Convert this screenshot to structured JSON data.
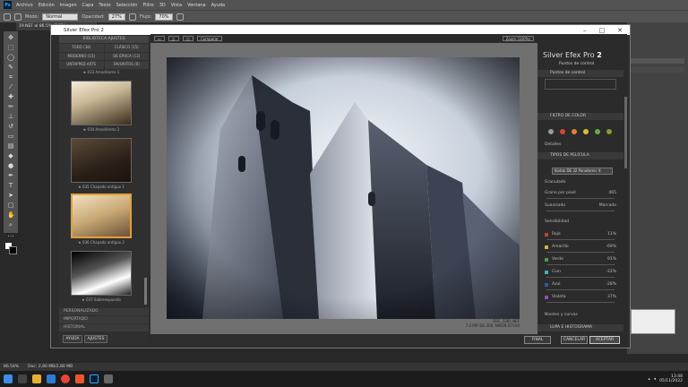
{
  "menu": {
    "items": [
      "Archivo",
      "Edición",
      "Imagen",
      "Capa",
      "Texto",
      "Selección",
      "Filtro",
      "3D",
      "Vista",
      "Ventana",
      "Ayuda"
    ]
  },
  "options": {
    "mode_label": "Modo:",
    "mode": "Normal",
    "opacity_label": "Opacidad:",
    "opacity": "27%",
    "flow_label": "Flujo:",
    "flow": "70%"
  },
  "doc_tab": "19.NEF al 86.5% (RGB/...",
  "silver": {
    "title": "Silver Efex Pro 2",
    "brand": "Silver Efex Pro",
    "brand_num": "2",
    "lib_header": "BIBLIOTECA AJUSTES",
    "tabs": [
      "TODO (38)",
      "CLÁSICO (15)",
      "MODERNO (15)",
      "DE ÉPOCA (13)",
      "UNTAPPED ARTS",
      "FAVORITOS (0)"
    ],
    "thumbs": [
      {
        "caption": "★ 033 Amarillento 1"
      },
      {
        "caption": "★ 034 Amarillento 2"
      },
      {
        "caption": "★ 035 Chapado antiguo 1"
      },
      {
        "caption": "★ 036 Chapado antiguo 2"
      },
      {
        "caption": "★ 037 Sobreexpuesto"
      }
    ],
    "left_sections": [
      "PERSONALIZADO",
      "IMPORTADO",
      "HISTORIAL"
    ],
    "help_btn": "AYUDA",
    "settings_btn": "AJUSTES",
    "compare_btn": "Comparar",
    "zoom": "Zoom (100%)",
    "photo_file": "DSC_2281.NEF",
    "photo_meta": "7.0 MP ISO 200, NIKON D7100",
    "control_points_label": "Puntos de control",
    "control_points_sub": "Puntos de control",
    "color_filter": "FILTRO DE COLOR",
    "details": "Detalles",
    "film_types": "TIPOS DE PELÍCULA",
    "film_select": "Kodak DE 32 Panatomic X",
    "grain": "Granulado",
    "grain_per_px": "Grano por píxel",
    "grain_value": "465",
    "soft": "Suavizado",
    "hard": "Marcado",
    "sensitivity": "Sensibilidad",
    "channels": [
      {
        "name": "Rojo",
        "value": "11%",
        "color": "#d23a2a"
      },
      {
        "name": "Amarillo",
        "value": "-69%",
        "color": "#e0b020"
      },
      {
        "name": "Verde",
        "value": "91%",
        "color": "#3aa640"
      },
      {
        "name": "Cian",
        "value": "-22%",
        "color": "#2ab8c8"
      },
      {
        "name": "Azul",
        "value": "-28%",
        "color": "#2a58c8"
      },
      {
        "name": "Violeta",
        "value": "37%",
        "color": "#a040c0"
      }
    ],
    "levels": "Niveles y curvas",
    "loupe": "LUPA E HISTOGRAMA",
    "finish": "FINAL",
    "cancel": "CANCELAR",
    "accept": "ACEPTAR"
  },
  "status": {
    "zoom": "86.54%",
    "doc": "Doc: 2,80 MB/2,80 MB"
  },
  "taskbar": {
    "time": "13:48",
    "date": "05/11/2022"
  },
  "colors": {
    "accent": "#e3a034",
    "ps_blue": "#31a8ff"
  }
}
